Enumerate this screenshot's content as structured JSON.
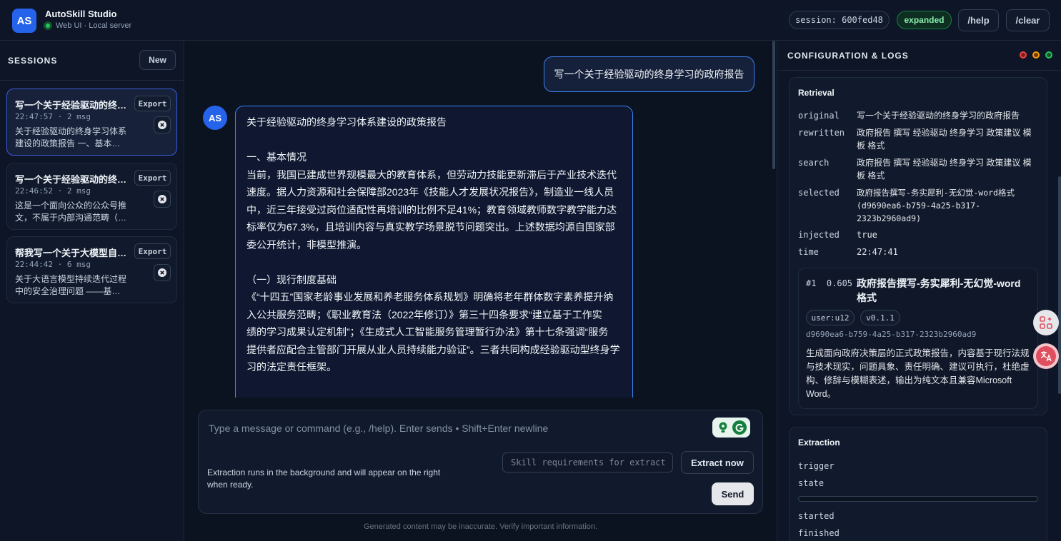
{
  "app": {
    "initials": "AS",
    "title": "AutoSkill Studio",
    "subtitle": "Web UI · Local server"
  },
  "header": {
    "session_label": "session: 600fed48",
    "mode_badge": "expanded",
    "help_button": "/help",
    "clear_button": "/clear"
  },
  "sidebar": {
    "title": "SESSIONS",
    "new_button": "New",
    "export_label": "Export",
    "sessions": [
      {
        "title": "写一个关于经验驱动的终身学习的政府报告",
        "meta": "22:47:57 · 2 msg",
        "preview_line1": "关于经验驱动的终身学习体系",
        "preview_line2": "建设的政策报告 一、基本…",
        "active": true
      },
      {
        "title": "写一个关于经验驱动的终身学习的政府报告",
        "meta": "22:46:52 · 2 msg",
        "preview_line1": "这是一个面向公众的公众号推",
        "preview_line2": "文，不属于内部沟通范畴（…",
        "active": false
      },
      {
        "title": "帮我写一个关于大模型自我进化的报告",
        "meta": "22:44:42 · 6 msg",
        "preview_line1": "关于大语言模型持续迭代过程",
        "preview_line2": "中的安全治理问题 ——基…",
        "active": false
      }
    ]
  },
  "chat": {
    "user_message": "写一个关于经验驱动的终身学习的政府报告",
    "assistant_initials": "AS",
    "assistant_message": {
      "title": "关于经验驱动的终身学习体系建设的政策报告",
      "section1_heading": "一、基本情况",
      "section1_lines": [
        "当前，我国已建成世界规模最大的教育体系，但劳动力技能更新滞后于产业技术迭代",
        "速度。据人力资源和社会保障部2023年《技能人才发展状况报告》，制造业一线人员",
        "中，近三年接受过岗位适配性再培训的比例不足41%；教育领域教师数字教学能力达",
        "标率仅为67.3%，且培训内容与真实教学场景脱节问题突出。上述数据均源自国家部",
        "委公开统计，非模型推演。"
      ],
      "section2_heading": "（一）现行制度基础",
      "section2_lines": [
        "《“十四五”国家老龄事业发展和养老服务体系规划》明确将老年群体数字素养提升纳",
        "入公共服务范畴；《职业教育法（2022年修订）》第三十四条要求“建立基于工作实",
        "绩的学习成果认定机制”；《生成式人工智能服务管理暂行办法》第十七条强调“服务",
        "提供者应配合主管部门开展从业人员持续能力验证”。三者共同构成经验驱动型终身学",
        "习的法定责任框架。"
      ]
    },
    "composer": {
      "placeholder": "Type a message or command (e.g., /help). Enter sends • Shift+Enter newline",
      "note": "Extraction runs in the background and will appear on the right when ready.",
      "skill_placeholder": "Skill requirements for extract",
      "extract_button": "Extract now",
      "send_button": "Send"
    },
    "disclaimer": "Generated content may be inaccurate. Verify important information."
  },
  "panel": {
    "title": "CONFIGURATION & LOGS",
    "window_dot_colors": [
      "#ef4444",
      "#f59e0b",
      "#22c55e"
    ],
    "retrieval": {
      "title": "Retrieval",
      "rows": [
        {
          "key": "original",
          "value": "写一个关于经验驱动的终身学习的政府报告"
        },
        {
          "key": "rewritten",
          "value": "政府报告 撰写 经验驱动 终身学习 政策建议 模板 格式"
        },
        {
          "key": "search",
          "value": "政府报告 撰写 经验驱动 终身学习 政策建议 模板 格式"
        },
        {
          "key": "selected",
          "value": "政府报告撰写-务实犀利-无幻觉-word格式 (d9690ea6-b759-4a25-b317-2323b2960ad9)"
        },
        {
          "key": "injected",
          "value": "true"
        },
        {
          "key": "time",
          "value": "22:47:41"
        }
      ],
      "hit": {
        "rank": "#1",
        "score": "0.605",
        "title": "政府报告撰写-务实犀利-无幻觉-word格式",
        "tags": [
          "user:u12",
          "v0.1.1"
        ],
        "id": "d9690ea6-b759-4a25-b317-2323b2960ad9",
        "description": "生成面向政府决策层的正式政策报告，内容基于现行法规与技术现实，问题具象、责任明确、建议可执行，杜绝虚构、修辞与模糊表述，输出为纯文本且兼容Microsoft Word。"
      }
    },
    "extraction": {
      "title": "Extraction",
      "keys": [
        "trigger",
        "state",
        "started",
        "finished"
      ],
      "progress": 0
    }
  }
}
